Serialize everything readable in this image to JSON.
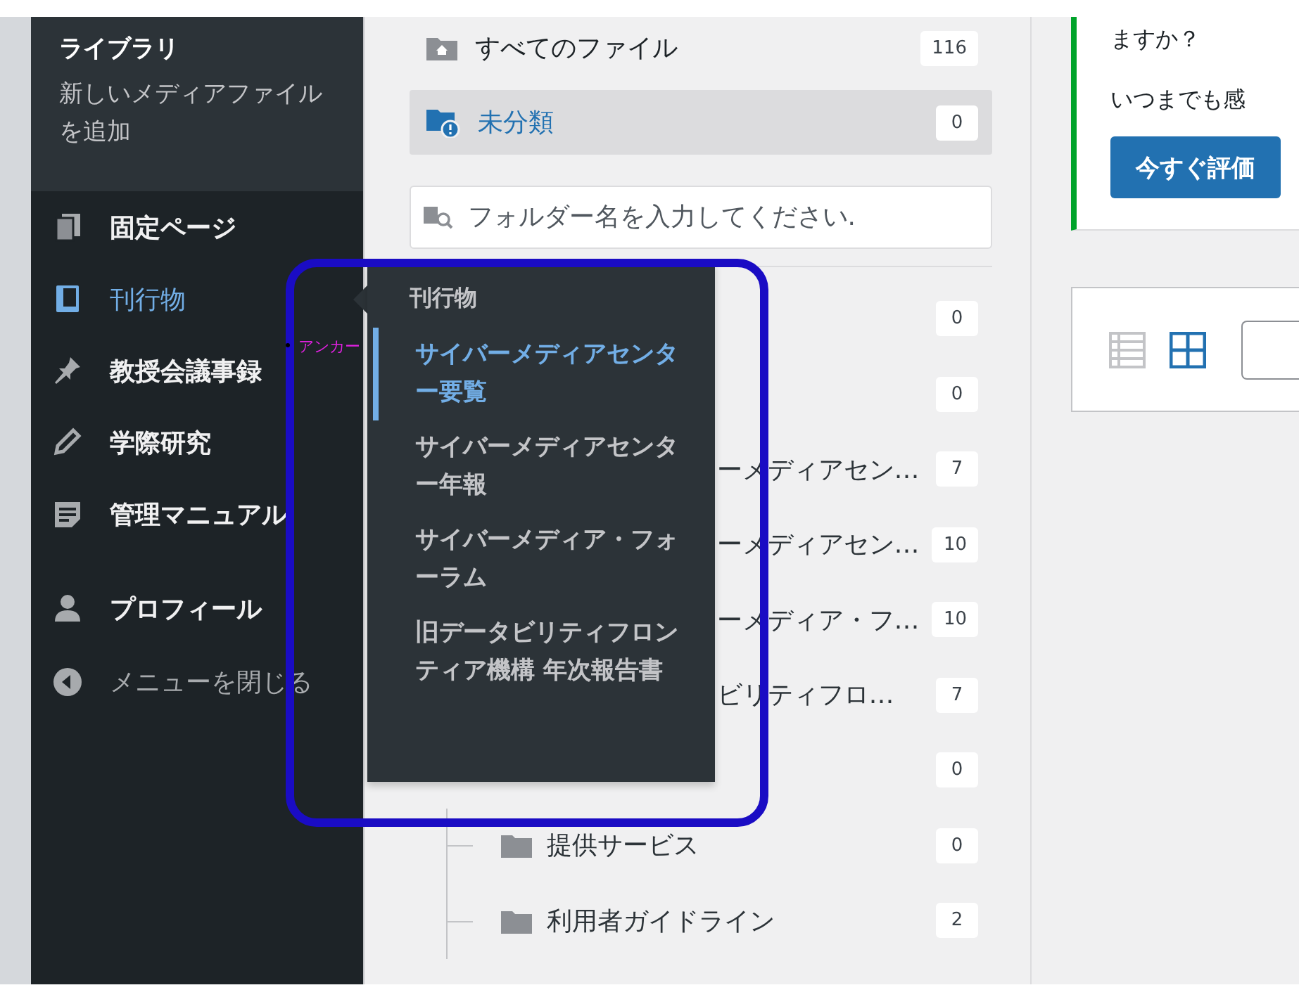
{
  "sidebar": {
    "submenu": {
      "title": "ライブラリ",
      "items": [
        "新しいメディアファイルを追加"
      ]
    },
    "groups": [
      [
        {
          "label": "固定ページ",
          "kind": "pages",
          "current": false
        },
        {
          "label": "刊行物",
          "kind": "book",
          "current": true
        },
        {
          "label": "教授会議事録",
          "kind": "pin",
          "current": false
        },
        {
          "label": "学際研究",
          "kind": "pencil",
          "current": false
        },
        {
          "label": "管理マニュアル",
          "kind": "document",
          "current": false
        }
      ],
      [
        {
          "label": "プロフィール",
          "kind": "user",
          "current": false
        }
      ]
    ],
    "close_menu": "メニューを閉じる"
  },
  "flyout": {
    "title": "刊行物",
    "items": [
      {
        "label": "サイバーメディアセンター要覧",
        "selected": true
      },
      {
        "label": "サイバーメディアセンター年報",
        "selected": false
      },
      {
        "label": "サイバーメディア・フォーラム",
        "selected": false
      },
      {
        "label": "旧データビリティフロンティア機構 年次報告書",
        "selected": false
      }
    ]
  },
  "folders": {
    "top": [
      {
        "label": "すべてのファイル",
        "count": "116",
        "kind": "all",
        "selected": false
      },
      {
        "label": "未分類",
        "count": "0",
        "kind": "uncategorized",
        "selected": true
      }
    ],
    "search": {
      "placeholder": "フォルダー名を入力してください."
    },
    "tree": [
      {
        "kind": "covered",
        "count": "0"
      },
      {
        "kind": "covered",
        "count": "0"
      },
      {
        "kind": "covered",
        "label": "ーメディアセン…",
        "count": "7"
      },
      {
        "kind": "covered",
        "label": "ーメディアセン…",
        "count": "10"
      },
      {
        "kind": "covered",
        "label": "ーメディア・フ…",
        "count": "10"
      },
      {
        "kind": "covered",
        "label": "ビリティフロ…",
        "count": "7"
      },
      {
        "kind": "covered",
        "count": "0"
      },
      {
        "kind": "folder",
        "label": "提供サービス",
        "count": "0"
      },
      {
        "kind": "folder",
        "label": "利用者ガイドライン",
        "count": "2"
      }
    ]
  },
  "notice": {
    "lines": [
      "ますか？",
      "いつまでも感"
    ],
    "button": "今すぐ評価"
  },
  "view_modes": [
    {
      "kind": "list",
      "selected": false
    },
    {
      "kind": "grid",
      "selected": true
    }
  ],
  "annotation": {
    "label": "アンカー"
  }
}
